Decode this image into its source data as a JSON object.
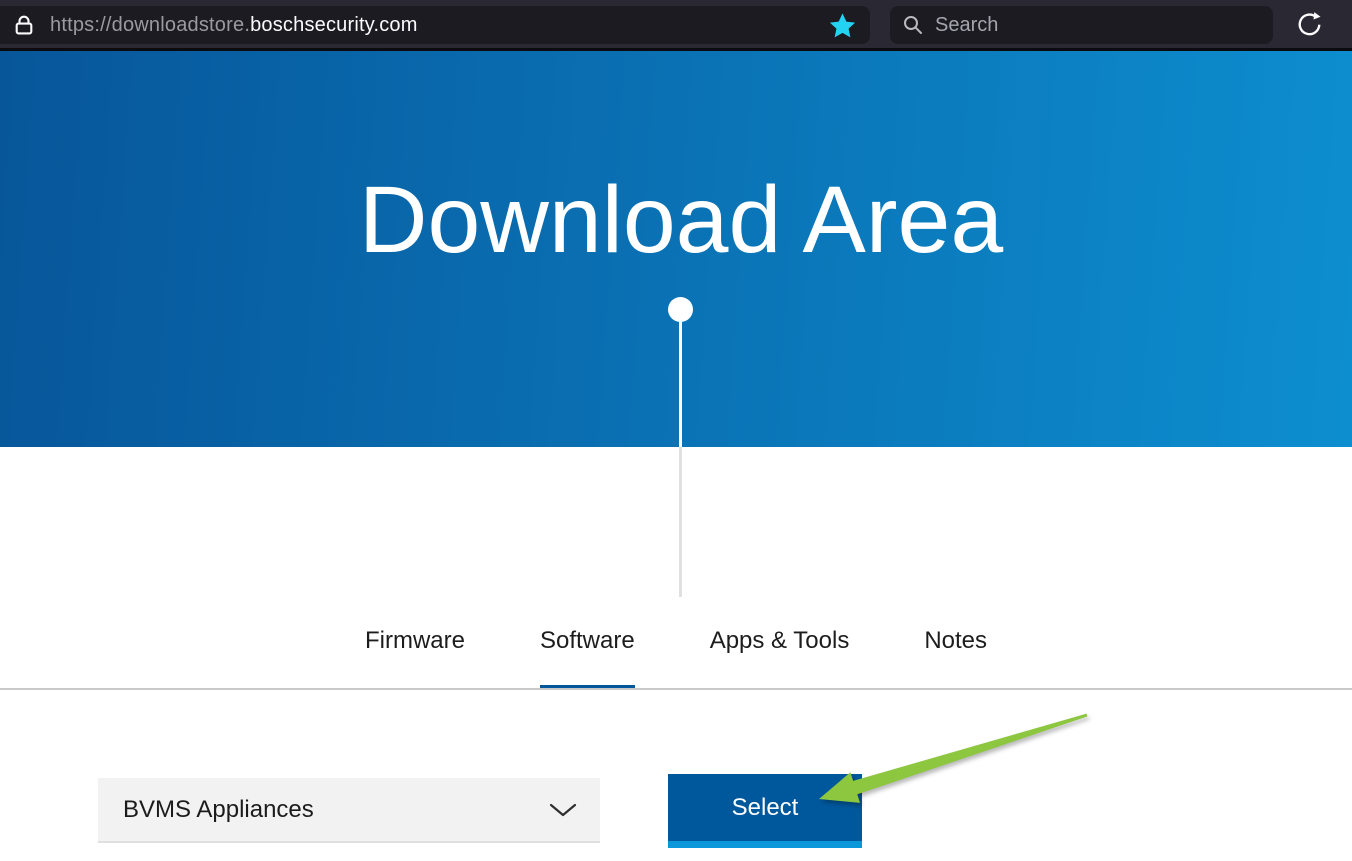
{
  "browser": {
    "url_prefix": "https://downloadstore.",
    "url_domain": "boschsecurity.com",
    "search_placeholder": "Search"
  },
  "hero": {
    "title": "Download Area"
  },
  "tabs": {
    "items": [
      {
        "label": "Firmware",
        "active": false
      },
      {
        "label": "Software",
        "active": true
      },
      {
        "label": "Apps & Tools",
        "active": false
      },
      {
        "label": "Notes",
        "active": false
      }
    ]
  },
  "filter": {
    "dropdown_value": "BVMS Appliances",
    "select_button_label": "Select"
  },
  "colors": {
    "toolbar_background": "#2a2933",
    "toolbar_field_background": "#1c1b22",
    "bookmark_star": "#24d3f2",
    "hero_gradient_start": "#07569a",
    "hero_gradient_end": "#0d8ecf",
    "active_tab_underline": "#00579b",
    "select_button": "#00589c",
    "select_button_accent": "#0b97da",
    "annotation_arrow": "#8dc63f",
    "dropdown_background": "#f2f2f2"
  }
}
